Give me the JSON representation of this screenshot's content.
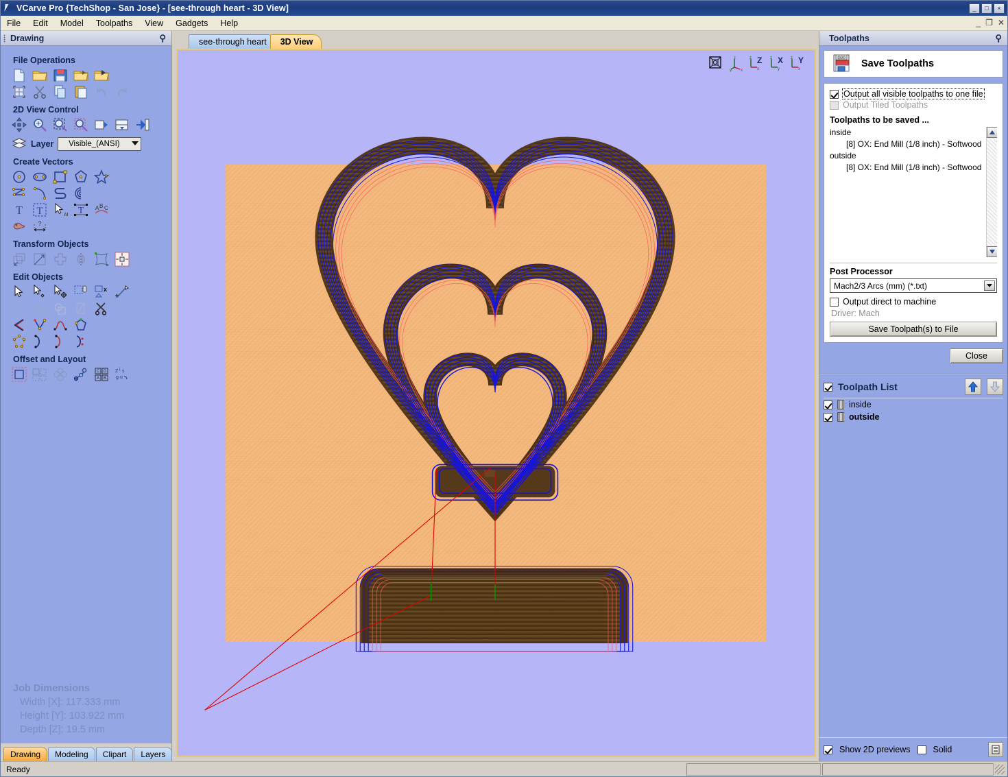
{
  "window": {
    "title": "VCarve Pro {TechShop - San Jose} - [see-through heart - 3D View]",
    "minimize": "_",
    "maximize": "□",
    "close": "×",
    "mdi_minimize": "_",
    "mdi_restore": "❐",
    "mdi_close": "✕"
  },
  "menu": {
    "items": [
      "File",
      "Edit",
      "Model",
      "Toolpaths",
      "View",
      "Gadgets",
      "Help"
    ]
  },
  "left_panel": {
    "caption": "Drawing",
    "pin": "⚲",
    "groups": [
      {
        "title": "File Operations",
        "rows": [
          [
            "new-file-icon",
            "open-folder-icon",
            "save-disk-icon",
            "open-recent-icon",
            "import-folder-icon"
          ],
          [
            "select-all-icon",
            "cut-scissors-icon",
            "copy-icon",
            "paste-icon",
            "undo-icon",
            "redo-icon"
          ]
        ]
      },
      {
        "title": "2D View Control",
        "rows": [
          [
            "pan-icon",
            "zoom-in-icon",
            "zoom-extents-icon",
            "zoom-selection-icon",
            "zoom-previous-icon",
            "split-view-icon",
            "toggle-panel-icon"
          ]
        ]
      },
      {
        "title": "Create Vectors",
        "rows": [
          [
            "circle-icon",
            "ellipse-icon",
            "rectangle-icon",
            "polygon-icon",
            "star-icon"
          ],
          [
            "polyline-icon",
            "arc-icon",
            "curve-icon",
            "spiral-icon"
          ],
          [
            "text-icon",
            "text-box-icon",
            "text-selection-icon",
            "text-on-curve-icon",
            "text-arc-icon"
          ],
          [
            "trace-bitmap-icon",
            "dimension-icon"
          ]
        ]
      },
      {
        "title": "Transform Objects",
        "rows": [
          [
            "move-icon",
            "scale-icon",
            "rotate-icon",
            "mirror-icon",
            "distort-icon",
            "align-icon"
          ]
        ]
      },
      {
        "title": "Edit Objects",
        "rows": [
          [
            "select-arrow-icon",
            "node-edit-icon",
            "move-nodes-icon",
            "join-vectors-icon",
            "close-vector-icon",
            "measure-icon"
          ],
          [
            "weld-icon",
            "subtract-icon",
            "intersect-icon",
            "crop-icon",
            "trim-icon"
          ],
          [
            "fillet-icon",
            "insert-node-icon",
            "smooth-node-icon",
            "close-with-line-icon"
          ],
          [
            "create-shape-icon",
            "curve-start-icon",
            "curve-end-icon",
            "curve-mid-icon"
          ]
        ]
      },
      {
        "title": "Offset and Layout",
        "rows": [
          [
            "offset-icon",
            "array-copy-icon",
            "circular-array-icon",
            "nest-icon",
            "block-copy-icon",
            "zigzag-icon"
          ]
        ]
      }
    ],
    "layer": {
      "label": "Layer",
      "value": "Visible_(ANSI)"
    },
    "job_dimensions": {
      "title": "Job Dimensions",
      "width": "Width  [X]: 117.333 mm",
      "height": "Height [Y]: 103.922 mm",
      "depth": "Depth  [Z]: 19.5 mm"
    },
    "tabs": [
      {
        "label": "Drawing",
        "active": true
      },
      {
        "label": "Modeling",
        "active": false
      },
      {
        "label": "Clipart",
        "active": false
      },
      {
        "label": "Layers",
        "active": false
      }
    ]
  },
  "document": {
    "tabs": [
      {
        "label": "see-through heart",
        "active": false
      },
      {
        "label": "3D View",
        "active": true
      }
    ],
    "view_buttons": [
      "isometric-view-icon",
      "perspective-view-icon",
      "z-axis-view-icon",
      "x-axis-view-icon",
      "y-axis-view-icon"
    ],
    "viewport": {
      "background_color": "#b5b5f8",
      "material_color": "#f2b87b",
      "toolpath_color": "#1414e0",
      "rapid_move_color": "#e00000",
      "description": "3D simulation of a see-through heart cut from softwood showing nested heart profile toolpaths with tabs"
    }
  },
  "right_panel": {
    "caption": "Toolpaths",
    "pin": "⚲",
    "save_toolpaths": {
      "label": "Save Toolpaths",
      "icon": "save-gcode-icon"
    },
    "output_all": {
      "label": "Output all visible toolpaths to one file",
      "checked": true
    },
    "output_tiled": {
      "label": "Output Tiled Toolpaths",
      "checked": false,
      "disabled": true
    },
    "to_be_saved_title": "Toolpaths to be saved ...",
    "toolpaths_to_save": [
      {
        "group": "inside",
        "tool": "[8] OX: End Mill (1/8 inch) - Softwood"
      },
      {
        "group": "outside",
        "tool": "[8] OX: End Mill (1/8 inch) - Softwood"
      }
    ],
    "post_processor": {
      "title": "Post Processor",
      "value": "Mach2/3 Arcs (mm) (*.txt)"
    },
    "output_direct": {
      "label": "Output direct to machine",
      "checked": false
    },
    "driver": "Driver: Mach",
    "save_to_file_button": "Save Toolpath(s) to File",
    "close_button": "Close",
    "toolpath_list": {
      "title": "Toolpath List",
      "checked": true,
      "move_up_icon": "arrow-up-icon",
      "move_down_icon": "arrow-down-icon",
      "items": [
        {
          "name": "inside",
          "checked": true,
          "bold": false
        },
        {
          "name": "outside",
          "checked": true,
          "bold": true
        }
      ]
    },
    "bottom": {
      "show_2d_previews": {
        "label": "Show 2D previews",
        "checked": true
      },
      "solid": {
        "label": "Solid",
        "checked": false
      },
      "toggle_icon": "preview-toggle-icon"
    }
  },
  "status_bar": {
    "message": "Ready",
    "cell1": "",
    "cell2": ""
  }
}
